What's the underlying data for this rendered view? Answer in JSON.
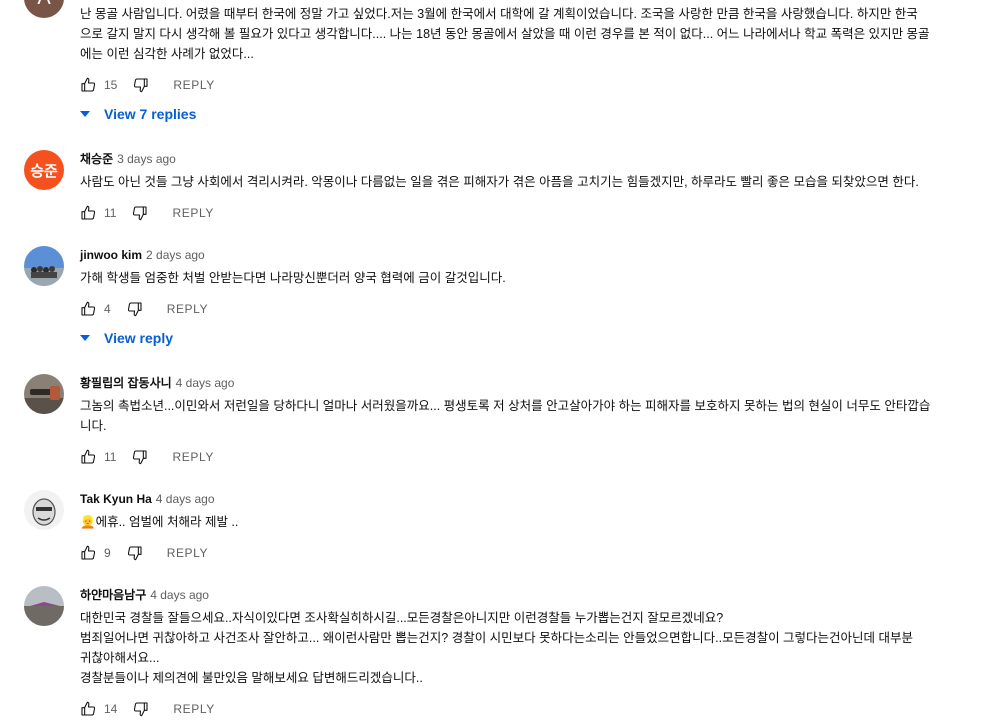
{
  "actions": {
    "reply_label": "REPLY"
  },
  "comments": [
    {
      "avatar_letter": "A",
      "avatar_color": "#795548",
      "text_lines": [
        "난 몽골 사람입니다. 어렸을 때부터 한국에 정말 가고 싶었다.저는 3월에 한국에서 대학에 갈 계획이었습니다.   조국을 사랑한 만큼 한국을 사랑했습니다. 하지만 한국",
        "으로 갈지 말지 다시 생각해 볼 필요가 있다고 생각합니다.... 나는 18년 동안 몽골에서 살았을 때 이런 경우를 본 적이 없다... 어느 나라에서나 학교 폭력은 있지만 몽골",
        "에는 이런 심각한 사례가 없었다..."
      ],
      "likes": "15",
      "view_replies": "View 7 replies"
    },
    {
      "author": "채승준",
      "time": "3 days ago",
      "avatar_text": "승준",
      "avatar_color": "#f4511e",
      "text_lines": [
        "사람도 아닌 것들 그냥 사회에서 격리시켜라. 악몽이나 다름없는 일을 겪은 피해자가 겪은 아픔을 고치기는 힘들겠지만, 하루라도 빨리 좋은 모습을 되찾았으면 한다."
      ],
      "likes": "11"
    },
    {
      "author": "jinwoo kim",
      "time": "2 days ago",
      "text_lines": [
        "가해 학생들 엄중한 처벌 안받는다면 나라망신뿐더러 양국 협력에 금이 갈것입니다."
      ],
      "likes": "4",
      "view_replies": "View reply"
    },
    {
      "author": "황필립의 잡동사니",
      "time": "4 days ago",
      "text_lines": [
        "그놈의 촉법소년...이민와서 저런일을 당하다니 얼마나 서러웠을까요... 평생토록 저 상처를 안고살아가야 하는 피해자를 보호하지 못하는 법의 현실이 너무도 안타깝습",
        "니다."
      ],
      "likes": "11"
    },
    {
      "author": "Tak Kyun Ha",
      "time": "4 days ago",
      "text_emoji": "👱",
      "text_lines": [
        "에휴.. 엄벌에 처해라 제발 .."
      ],
      "likes": "9"
    },
    {
      "author": "하얀마음남구",
      "time": "4 days ago",
      "text_lines": [
        "대한민국 경찰들 잘들으세요..자식이있다면  조사확실히하시길...모든경찰은아니지만 이런경찰들 누가뽑는건지 잘모르겠네요?",
        "범죄일어나면 귀찮아하고 사건조사 잘안하고... 왜이런사람만 뽑는건지? 경찰이   시민보다 못하다는소리는 안들었으면합니다..모든경찰이 그렇다는건아닌데 대부분",
        "귀찮아해서요...",
        "경찰분들이나 제의견에 불만있음 말해보세요  답변해드리겠습니다.."
      ],
      "likes": "14"
    }
  ]
}
